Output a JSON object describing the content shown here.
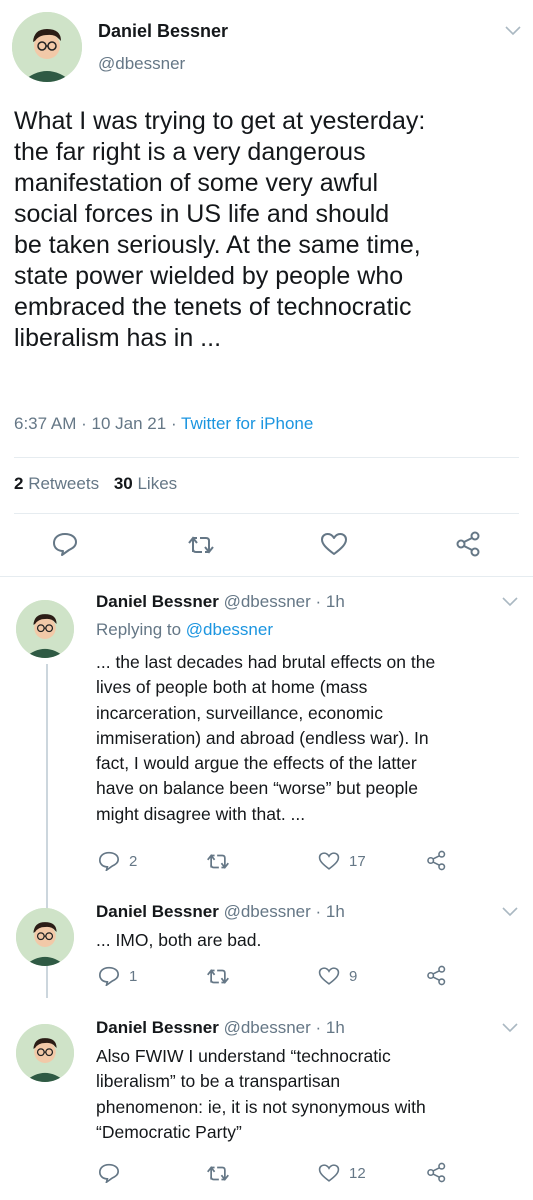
{
  "main_tweet": {
    "display_name": "Daniel Bessner",
    "handle": "@dbessner",
    "text_lines": [
      "What I was trying to get at yesterday:",
      "the far right is a very dangerous",
      "manifestation of some very awful",
      "social forces in US life and should",
      "be taken seriously. At the same time,",
      "state power wielded by people who",
      "embraced the tenets of technocratic",
      "liberalism has in ..."
    ],
    "time": "6:37 AM",
    "date": "10 Jan 21",
    "sep": "·",
    "source": "Twitter for iPhone",
    "retweets_count": "2",
    "retweets_label": "Retweets",
    "likes_count": "30",
    "likes_label": "Likes"
  },
  "replies": [
    {
      "display_name": "Daniel Bessner",
      "handle": "@dbessner",
      "time": "· 1h",
      "replying_label": "Replying to",
      "replying_handle": "@dbessner",
      "text_lines": [
        "... the last decades had brutal effects on the",
        "lives of people both at home (mass",
        "incarceration, surveillance, economic",
        "immiseration) and abroad (endless war). In",
        "fact, I would argue the effects of the latter",
        "have on balance been “worse” but people",
        "might disagree with that. ..."
      ],
      "reply_count": "2",
      "retweet_count": "",
      "like_count": "17"
    },
    {
      "display_name": "Daniel Bessner",
      "handle": "@dbessner",
      "time": "· 1h",
      "text_lines": [
        "... IMO, both are bad."
      ],
      "reply_count": "1",
      "retweet_count": "",
      "like_count": "9"
    },
    {
      "display_name": "Daniel Bessner",
      "handle": "@dbessner",
      "time": "· 1h",
      "text_lines": [
        "Also FWIW I understand “technocratic",
        "liberalism” to be a transpartisan",
        "phenomenon: ie, it is not synonymous with",
        "“Democratic Party”"
      ],
      "reply_count": "",
      "retweet_count": "",
      "like_count": "12"
    }
  ],
  "icons": {
    "reply": "reply-icon",
    "retweet": "retweet-icon",
    "like": "heart-icon",
    "share": "share-icon",
    "menu": "chevron-down-icon"
  },
  "colors": {
    "link": "#1b95e0",
    "muted": "#657786",
    "icon": "#657786",
    "text": "#14171a"
  }
}
